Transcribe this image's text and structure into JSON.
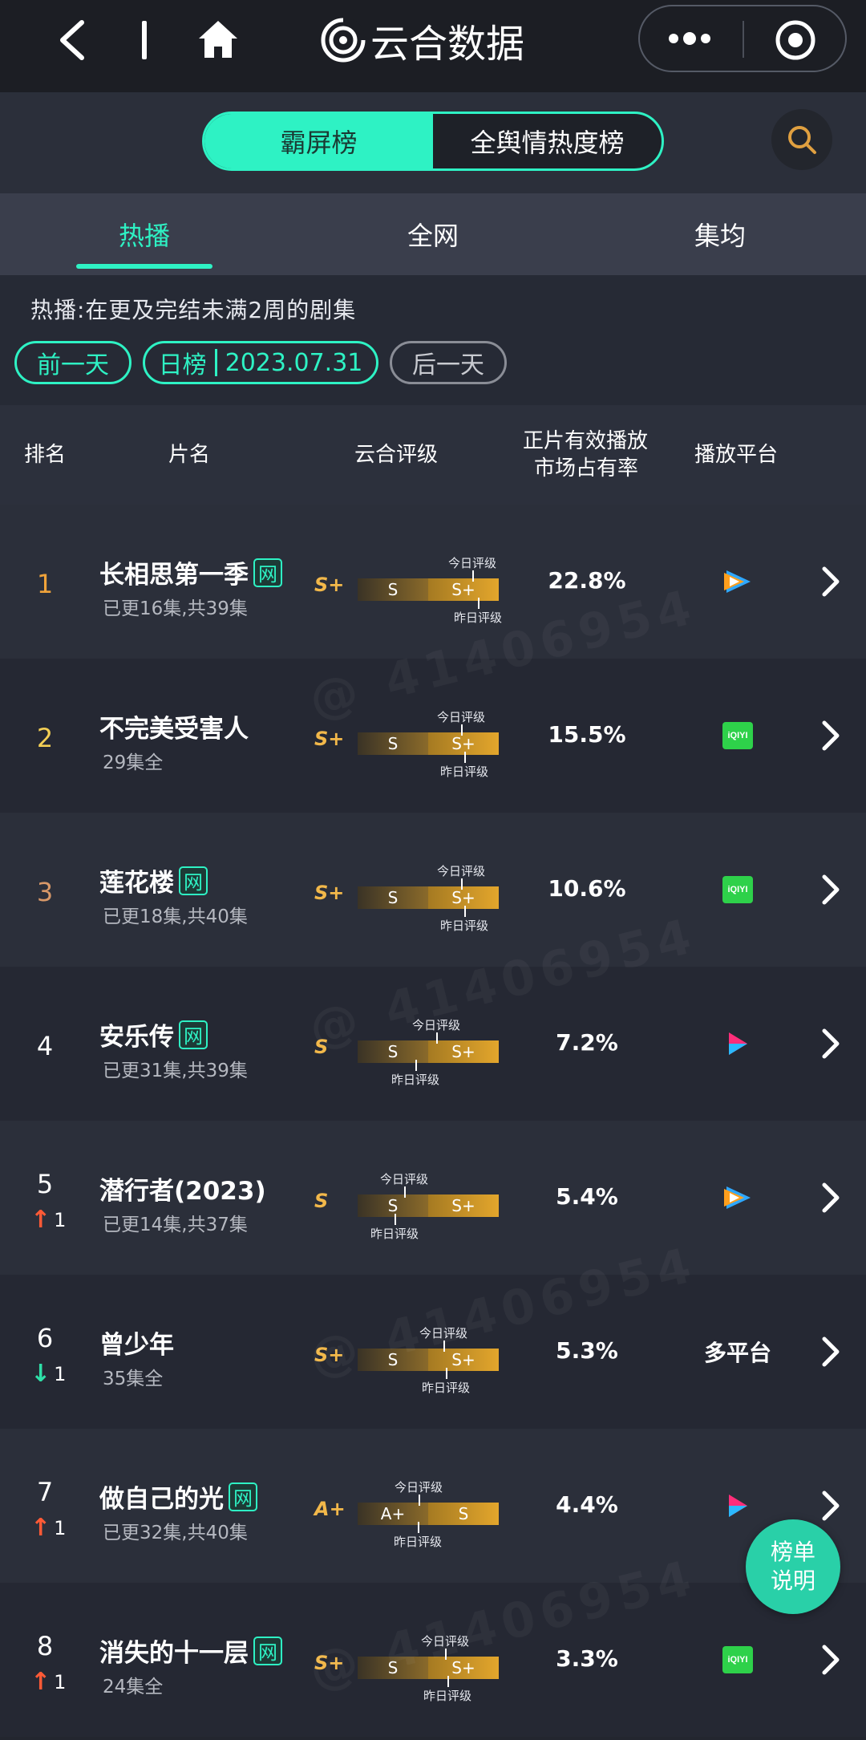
{
  "app": {
    "title": "云合数据"
  },
  "board_switch": {
    "active": "霸屏榜",
    "inactive": "全舆情热度榜"
  },
  "tabs": [
    {
      "label": "热播"
    },
    {
      "label": "全网"
    },
    {
      "label": "集均"
    }
  ],
  "info": {
    "text": "热播:在更及完结未满2周的剧集"
  },
  "date_nav": {
    "prev": "前一天",
    "type": "日榜",
    "date": "2023.07.31",
    "next": "后一天"
  },
  "table_headers": {
    "rank": "排名",
    "title": "片名",
    "grade": "云合评级",
    "share_line1": "正片有效播放",
    "share_line2": "市场占有率",
    "platform": "播放平台"
  },
  "rate_labels": {
    "today": "今日评级",
    "yesterday": "昨日评级"
  },
  "rows": [
    {
      "rank": "1",
      "title": "长相思第一季",
      "net": "网",
      "sub": "已更16集,共39集",
      "grade": "S+",
      "seg_left": "S",
      "seg_right": "S+",
      "share": "22.8%",
      "platform": "tencent"
    },
    {
      "rank": "2",
      "title": "不完美受害人",
      "net": "",
      "sub": "29集全",
      "grade": "S+",
      "seg_left": "S",
      "seg_right": "S+",
      "share": "15.5%",
      "platform": "iqiyi"
    },
    {
      "rank": "3",
      "title": "莲花楼",
      "net": "网",
      "sub": "已更18集,共40集",
      "grade": "S+",
      "seg_left": "S",
      "seg_right": "S+",
      "share": "10.6%",
      "platform": "iqiyi"
    },
    {
      "rank": "4",
      "title": "安乐传",
      "net": "网",
      "sub": "已更31集,共39集",
      "grade": "S",
      "seg_left": "S",
      "seg_right": "S+",
      "share": "7.2%",
      "platform": "youku"
    },
    {
      "rank": "5",
      "trend": "up",
      "trend_num": "1",
      "title": "潜行者(2023)",
      "net": "",
      "sub": "已更14集,共37集",
      "grade": "S",
      "seg_left": "S",
      "seg_right": "S+",
      "share": "5.4%",
      "platform": "tencent"
    },
    {
      "rank": "6",
      "trend": "down",
      "trend_num": "1",
      "title": "曾少年",
      "net": "",
      "sub": "35集全",
      "grade": "S+",
      "seg_left": "S",
      "seg_right": "S+",
      "share": "5.3%",
      "platform": "multi",
      "platform_text": "多平台"
    },
    {
      "rank": "7",
      "trend": "up",
      "trend_num": "1",
      "title": "做自己的光",
      "net": "网",
      "sub": "已更32集,共40集",
      "grade": "A+",
      "seg_left": "A+",
      "seg_right": "S",
      "share": "4.4%",
      "platform": "youku"
    },
    {
      "rank": "8",
      "trend": "up",
      "trend_num": "1",
      "title": "消失的十一层",
      "net": "网",
      "sub": "24集全",
      "grade": "S+",
      "seg_left": "S",
      "seg_right": "S+",
      "share": "3.3%",
      "platform": "iqiyi"
    }
  ],
  "float_button": {
    "line1": "榜单",
    "line2": "说明"
  },
  "watermark": {
    "text": "@ 41406954"
  },
  "colors": {
    "accent": "#2ef2c4",
    "gold": "#f2b84a",
    "up": "#ff5a36",
    "down": "#2ee0a8"
  }
}
